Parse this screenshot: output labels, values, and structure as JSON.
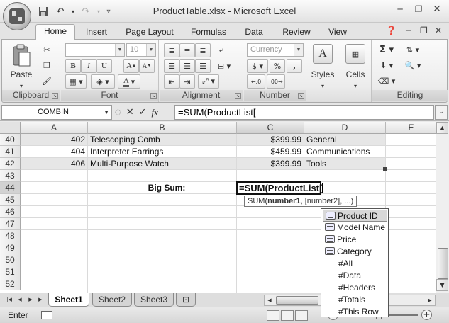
{
  "window": {
    "title": "ProductTable.xlsx - Microsoft Excel"
  },
  "ribbon": {
    "tabs": [
      "Home",
      "Insert",
      "Page Layout",
      "Formulas",
      "Data",
      "Review",
      "View"
    ],
    "active_tab": "Home",
    "groups": {
      "clipboard": {
        "label": "Clipboard",
        "paste_label": "Paste"
      },
      "font": {
        "label": "Font",
        "font_size": "10"
      },
      "alignment": {
        "label": "Alignment"
      },
      "number": {
        "label": "Number",
        "format": "Currency",
        "currency_symbol": "$",
        "percent_symbol": "%"
      },
      "styles": {
        "label": "Styles"
      },
      "cells": {
        "label": "Cells"
      },
      "editing": {
        "label": "Editing"
      }
    }
  },
  "formula_bar": {
    "name_box": "COMBIN",
    "formula": "=SUM(ProductList["
  },
  "grid": {
    "columns": [
      "A",
      "B",
      "C",
      "D",
      "E"
    ],
    "row_numbers": [
      "40",
      "41",
      "42",
      "43",
      "44",
      "45",
      "46",
      "47",
      "48",
      "49",
      "50",
      "51",
      "52"
    ],
    "data_rows": [
      {
        "row": "40",
        "id": "402",
        "name": "Telescoping Comb",
        "price": "$399.99",
        "category": "General"
      },
      {
        "row": "41",
        "id": "404",
        "name": "Interpreter Earrings",
        "price": "$459.99",
        "category": "Communications"
      },
      {
        "row": "42",
        "id": "406",
        "name": "Multi-Purpose Watch",
        "price": "$399.99",
        "category": "Tools"
      }
    ],
    "big_sum_label": "Big Sum:",
    "active_cell_text": "=SUM(ProductList[",
    "tooltip_prefix": "SUM(",
    "tooltip_bold_arg": "number1",
    "tooltip_rest": ", [number2], ...)"
  },
  "autocomplete": {
    "items": [
      {
        "label": "Product ID",
        "icon": "table-column-icon",
        "selected": true
      },
      {
        "label": "Model Name",
        "icon": "table-column-icon",
        "selected": false
      },
      {
        "label": "Price",
        "icon": "table-column-icon",
        "selected": false
      },
      {
        "label": "Category",
        "icon": "table-column-icon",
        "selected": false
      },
      {
        "label": "#All",
        "icon": "",
        "selected": false
      },
      {
        "label": "#Data",
        "icon": "",
        "selected": false
      },
      {
        "label": "#Headers",
        "icon": "",
        "selected": false
      },
      {
        "label": "#Totals",
        "icon": "",
        "selected": false
      },
      {
        "label": "#This Row",
        "icon": "",
        "selected": false
      }
    ]
  },
  "sheets": {
    "tabs": [
      "Sheet1",
      "Sheet2",
      "Sheet3"
    ],
    "active": "Sheet1"
  },
  "status_bar": {
    "mode": "Enter"
  }
}
